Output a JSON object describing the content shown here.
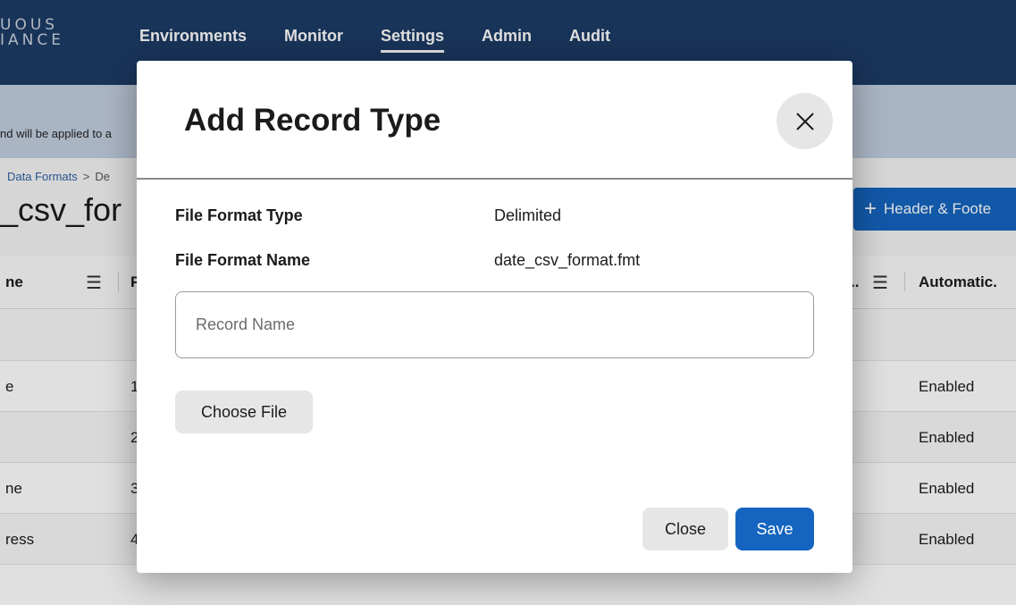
{
  "app": {
    "logo_line1": "UOUS",
    "logo_line2": "IANCE"
  },
  "nav": {
    "items": [
      {
        "label": "Environments",
        "active": false
      },
      {
        "label": "Monitor",
        "active": false
      },
      {
        "label": "Settings",
        "active": true
      },
      {
        "label": "Admin",
        "active": false
      },
      {
        "label": "Audit",
        "active": false
      }
    ]
  },
  "banner": {
    "text": "nd will be applied to a"
  },
  "breadcrumb": {
    "link": "Data Formats",
    "separator": ">",
    "tail": "De"
  },
  "page": {
    "title": "_csv_for",
    "header_footer_button": "Header & Foote"
  },
  "grid": {
    "columns": [
      {
        "label": "ne"
      },
      {
        "label": "F"
      },
      {
        "label": ".."
      },
      {
        "label": "Automatic."
      }
    ],
    "rows": [
      {
        "name": "",
        "num": "",
        "status": ""
      },
      {
        "name": "e",
        "num": "1",
        "status": "Enabled"
      },
      {
        "name": "",
        "num": "2",
        "status": "Enabled"
      },
      {
        "name": "ne",
        "num": "3",
        "status": "Enabled"
      },
      {
        "name": "ress",
        "num": "4",
        "status": "Enabled"
      }
    ]
  },
  "modal": {
    "title": "Add Record Type",
    "fields": [
      {
        "label": "File Format Type",
        "value": "Delimited"
      },
      {
        "label": "File Format Name",
        "value": "date_csv_format.fmt"
      }
    ],
    "record_name": {
      "value": "",
      "placeholder": "Record Name"
    },
    "choose_file_label": "Choose File",
    "close_label": "Close",
    "save_label": "Save"
  },
  "colors": {
    "topbar": "#1d3c66",
    "banner": "#c2cfe0",
    "primary": "#1565c0",
    "secondary_button": "#e6e6e6"
  }
}
